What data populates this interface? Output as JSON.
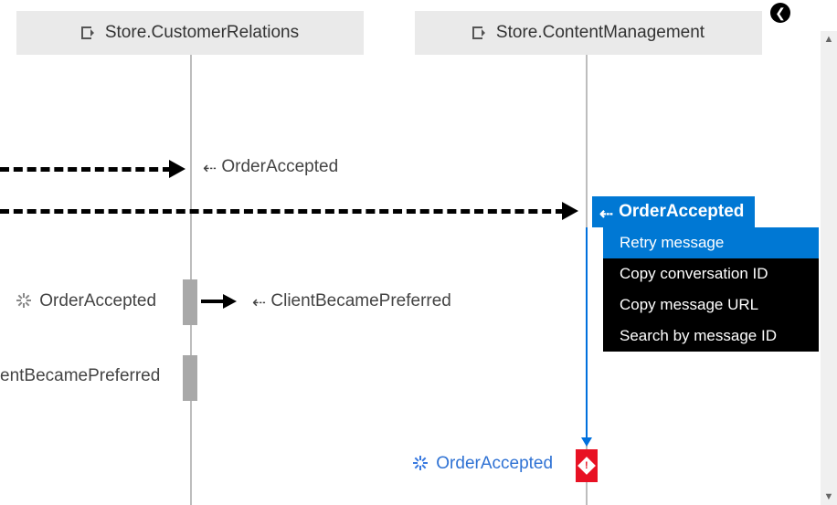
{
  "lanes": {
    "customerRelations": "Store.CustomerRelations",
    "contentManagement": "Store.ContentManagement"
  },
  "messages": {
    "orderAccepted_in1": "OrderAccepted",
    "orderAccepted_selected": "OrderAccepted",
    "orderAccepted_proc1": "OrderAccepted",
    "clientBecamePreferred_out": "ClientBecamePreferred",
    "clientBecamePreferred_cut": "entBecamePreferred",
    "orderAccepted_proc2": "OrderAccepted"
  },
  "contextMenu": {
    "items": [
      "Retry message",
      "Copy conversation ID",
      "Copy message URL",
      "Search by message ID"
    ],
    "selectedIndex": 0
  }
}
